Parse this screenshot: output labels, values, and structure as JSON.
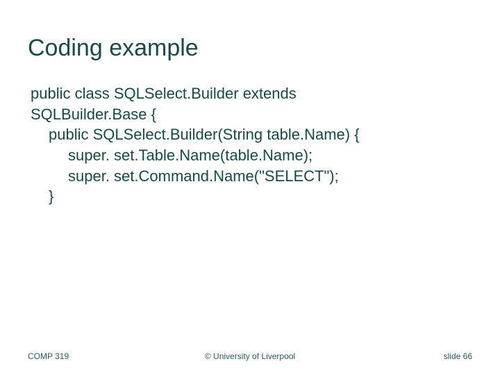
{
  "title": "Coding example",
  "code": {
    "l0": "public class SQLSelect.Builder extends",
    "l1": "SQLBuilder.Base {",
    "l2": "public SQLSelect.Builder(String table.Name) {",
    "l3": "super. set.Table.Name(table.Name);",
    "l4": "super. set.Command.Name(\"SELECT\");",
    "l5": "}"
  },
  "footer": {
    "left": "COMP 319",
    "center": "© University of Liverpool",
    "right": "slide  66"
  }
}
